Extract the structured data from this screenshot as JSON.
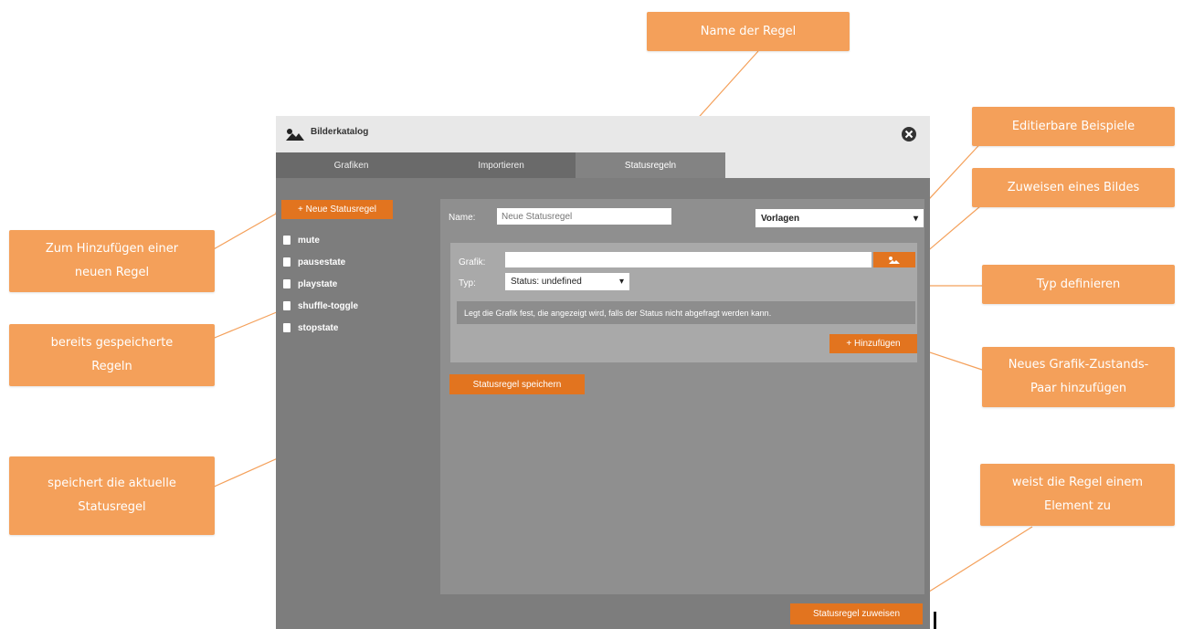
{
  "window": {
    "title": "Bilderkatalog",
    "close_icon": "close-circle-icon",
    "tabs": [
      {
        "label": "Grafiken"
      },
      {
        "label": "Importieren"
      },
      {
        "label": "Statusregeln"
      }
    ],
    "active_tab": "Statusregeln"
  },
  "sidebar": {
    "new_rule_label": "+ Neue Statusregel",
    "rules": [
      {
        "label": "mute"
      },
      {
        "label": "pausestate"
      },
      {
        "label": "playstate"
      },
      {
        "label": "shuffle-toggle"
      },
      {
        "label": "stopstate"
      }
    ]
  },
  "editor": {
    "name_label": "Name:",
    "name_placeholder": "Neue Statusregel",
    "name_value": "",
    "templates_select": "Vorlagen",
    "grafik_label": "Grafik:",
    "grafik_value": "",
    "grafik_button_icon": "image-icon",
    "typ_label": "Typ:",
    "typ_value": "Status: undefined",
    "info_text": "Legt die Grafik fest, die angezeigt wird, falls der Status nicht abgefragt werden kann.",
    "add_button": "+ Hinzufügen",
    "save_button": "Statusregel speichern",
    "assign_button": "Statusregel zuweisen"
  },
  "callouts": {
    "name_der_regel": "Name der Regel",
    "editierbare_beispiele": "Editierbare Beispiele",
    "zuweisen_bild": "Zuweisen eines Bildes",
    "typ_definieren": "Typ definieren",
    "neues_paar_line1": "Neues Grafik-Zustands-",
    "neues_paar_line2": "Paar hinzufügen",
    "weist_zu_line1": "weist die Regel einem",
    "weist_zu_line2": "Element zu",
    "zum_hinzufuegen_line1": "Zum Hinzufügen einer",
    "zum_hinzufuegen_line2": "neuen Regel",
    "gespeichert_line1": "bereits gespeicherte",
    "gespeichert_line2": "Regeln",
    "speichert_line1": "speichert die aktuelle",
    "speichert_line2": "Statusregel"
  },
  "colors": {
    "callout": "#f4a05a",
    "button": "#e2741f",
    "window_bg": "#7d7d7d",
    "panel_bg": "#8f8f8f",
    "connector": "#f4a05a"
  }
}
